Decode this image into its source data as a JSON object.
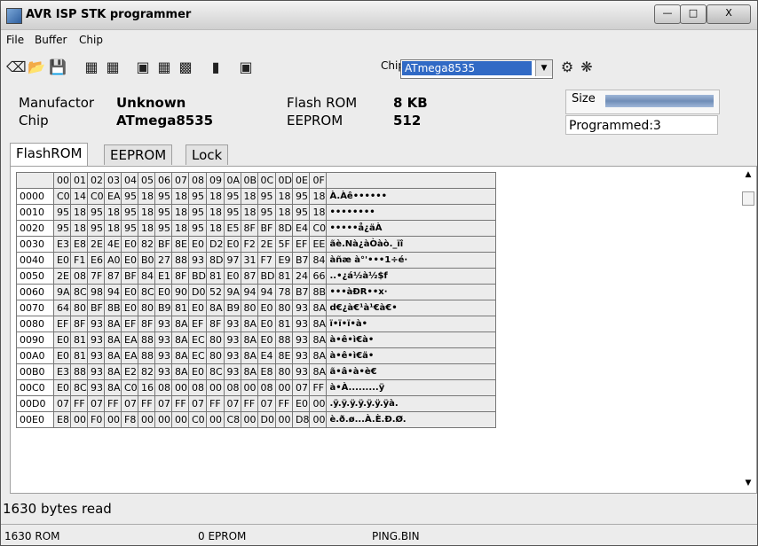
{
  "window": {
    "title": "AVR ISP STK programmer",
    "min_label": "—",
    "max_label": "□",
    "close_label": "X"
  },
  "menu": [
    "File",
    "Buffer",
    "Chip"
  ],
  "toolbar": {
    "chip_label": "Chip",
    "chip_value": "ATmega8535",
    "dropdown_arrow": "▼"
  },
  "info": {
    "manufactor_label": "Manufactor",
    "manufactor_value": "Unknown",
    "chip_label": "Chip",
    "chip_value": "ATmega8535",
    "flash_label": "Flash ROM",
    "flash_value": "8 KB",
    "eeprom_label": "EEPROM",
    "eeprom_value": "512",
    "size_label": "Size",
    "programmed": "Programmed:3"
  },
  "tabs": [
    "FlashROM",
    "EEPROM",
    "Lock and Fuse Bits"
  ],
  "hex": {
    "columns": [
      "00",
      "01",
      "02",
      "03",
      "04",
      "05",
      "06",
      "07",
      "08",
      "09",
      "0A",
      "0B",
      "0C",
      "0D",
      "0E",
      "0F"
    ],
    "rows": [
      {
        "addr": "0000",
        "bytes": [
          "C0",
          "14",
          "C0",
          "EA",
          "95",
          "18",
          "95",
          "18",
          "95",
          "18",
          "95",
          "18",
          "95",
          "18",
          "95",
          "18"
        ],
        "ascii": "À.Àê••••••"
      },
      {
        "addr": "0010",
        "bytes": [
          "95",
          "18",
          "95",
          "18",
          "95",
          "18",
          "95",
          "18",
          "95",
          "18",
          "95",
          "18",
          "95",
          "18",
          "95",
          "18"
        ],
        "ascii": "••••••••"
      },
      {
        "addr": "0020",
        "bytes": [
          "95",
          "18",
          "95",
          "18",
          "95",
          "18",
          "95",
          "18",
          "95",
          "18",
          "E5",
          "8F",
          "BF",
          "8D",
          "E4",
          "C0"
        ],
        "ascii": "•••••å¿äÀ"
      },
      {
        "addr": "0030",
        "bytes": [
          "E3",
          "E8",
          "2E",
          "4E",
          "E0",
          "82",
          "BF",
          "8E",
          "E0",
          "D2",
          "E0",
          "F2",
          "2E",
          "5F",
          "EF",
          "EE"
        ],
        "ascii": "ãè.Nà¿àÒàò._ïî"
      },
      {
        "addr": "0040",
        "bytes": [
          "E0",
          "F1",
          "E6",
          "A0",
          "E0",
          "B0",
          "27",
          "88",
          "93",
          "8D",
          "97",
          "31",
          "F7",
          "E9",
          "B7",
          "84"
        ],
        "ascii": "àñæ à°'•••1÷é·"
      },
      {
        "addr": "0050",
        "bytes": [
          "2E",
          "08",
          "7F",
          "87",
          "BF",
          "84",
          "E1",
          "8F",
          "BD",
          "81",
          "E0",
          "87",
          "BD",
          "81",
          "24",
          "66"
        ],
        "ascii": "..•¿á½à½$f"
      },
      {
        "addr": "0060",
        "bytes": [
          "9A",
          "8C",
          "98",
          "94",
          "E0",
          "8C",
          "E0",
          "90",
          "D0",
          "52",
          "9A",
          "94",
          "94",
          "78",
          "B7",
          "8B"
        ],
        "ascii": "•••àÐR••x·"
      },
      {
        "addr": "0070",
        "bytes": [
          "64",
          "80",
          "BF",
          "8B",
          "E0",
          "80",
          "B9",
          "81",
          "E0",
          "8A",
          "B9",
          "80",
          "E0",
          "80",
          "93",
          "8A"
        ],
        "ascii": "d€¿à€¹à¹€à€•"
      },
      {
        "addr": "0080",
        "bytes": [
          "EF",
          "8F",
          "93",
          "8A",
          "EF",
          "8F",
          "93",
          "8A",
          "EF",
          "8F",
          "93",
          "8A",
          "E0",
          "81",
          "93",
          "8A"
        ],
        "ascii": "ï•ï•ï•à•"
      },
      {
        "addr": "0090",
        "bytes": [
          "E0",
          "81",
          "93",
          "8A",
          "EA",
          "88",
          "93",
          "8A",
          "EC",
          "80",
          "93",
          "8A",
          "E0",
          "88",
          "93",
          "8A"
        ],
        "ascii": "à•ê•ì€à•"
      },
      {
        "addr": "00A0",
        "bytes": [
          "E0",
          "81",
          "93",
          "8A",
          "EA",
          "88",
          "93",
          "8A",
          "EC",
          "80",
          "93",
          "8A",
          "E4",
          "8E",
          "93",
          "8A"
        ],
        "ascii": "à•ê•ì€ä•"
      },
      {
        "addr": "00B0",
        "bytes": [
          "E3",
          "88",
          "93",
          "8A",
          "E2",
          "82",
          "93",
          "8A",
          "E0",
          "8C",
          "93",
          "8A",
          "E8",
          "80",
          "93",
          "8A"
        ],
        "ascii": "ã•â•à•è€"
      },
      {
        "addr": "00C0",
        "bytes": [
          "E0",
          "8C",
          "93",
          "8A",
          "C0",
          "16",
          "08",
          "00",
          "08",
          "00",
          "08",
          "00",
          "08",
          "00",
          "07",
          "FF"
        ],
        "ascii": "à•À.........ÿ"
      },
      {
        "addr": "00D0",
        "bytes": [
          "07",
          "FF",
          "07",
          "FF",
          "07",
          "FF",
          "07",
          "FF",
          "07",
          "FF",
          "07",
          "FF",
          "07",
          "FF",
          "E0",
          "00"
        ],
        "ascii": ".ÿ.ÿ.ÿ.ÿ.ÿ.ÿ.ÿà."
      },
      {
        "addr": "00E0",
        "bytes": [
          "E8",
          "00",
          "F0",
          "00",
          "F8",
          "00",
          "00",
          "00",
          "C0",
          "00",
          "C8",
          "00",
          "D0",
          "00",
          "D8",
          "00"
        ],
        "ascii": "è.ð.ø...À.È.Ð.Ø."
      }
    ]
  },
  "bytes_read": "1630 bytes read",
  "status": {
    "rom": "1630 ROM",
    "eprom": "0 EPROM",
    "file": "PING.BIN"
  },
  "colors": {
    "selection": "#316ac5",
    "grid_cell": "#ececec"
  }
}
